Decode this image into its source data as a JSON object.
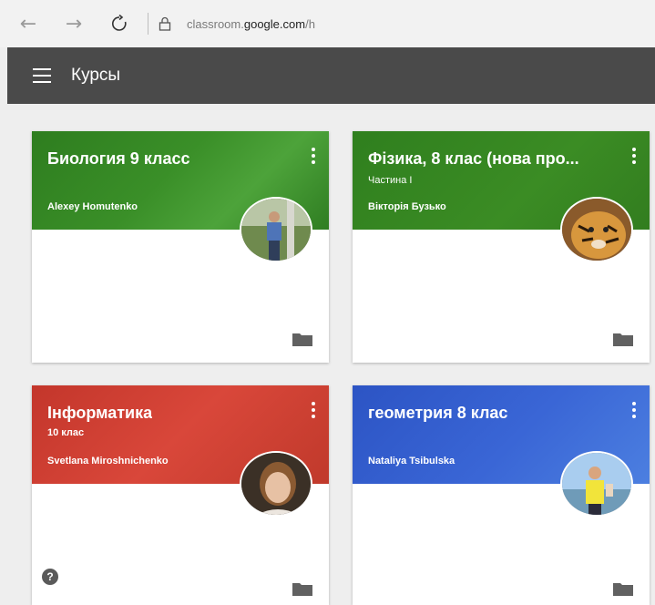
{
  "browser": {
    "url_prefix": "classroom.",
    "url_domain": "google.com",
    "url_suffix": "/h"
  },
  "header": {
    "title": "Курсы"
  },
  "courses": [
    {
      "title": "Биология 9 класс",
      "section": "",
      "teacher": "Alexey Homutenko",
      "color": "#3a8f28"
    },
    {
      "title": "Фізика, 8 клас (нова про...",
      "section": "Частина I",
      "teacher": "Вікторія Бузько",
      "color": "#3b8c24"
    },
    {
      "title": "Інформатика",
      "section": "10 клас",
      "teacher": "Svetlana Miroshnichenko",
      "color": "#d9473a"
    },
    {
      "title": "геометрия 8 клас",
      "section": "",
      "teacher": "Nataliya Tsibulska",
      "color": "#3a66d6"
    }
  ],
  "help": {
    "label": "?"
  },
  "icons": {
    "back": "arrow-left-icon",
    "forward": "arrow-right-icon",
    "reload": "reload-icon",
    "lock": "lock-icon",
    "menu": "hamburger-menu-icon",
    "more": "more-vert-icon",
    "folder": "folder-icon",
    "help": "help-icon"
  }
}
